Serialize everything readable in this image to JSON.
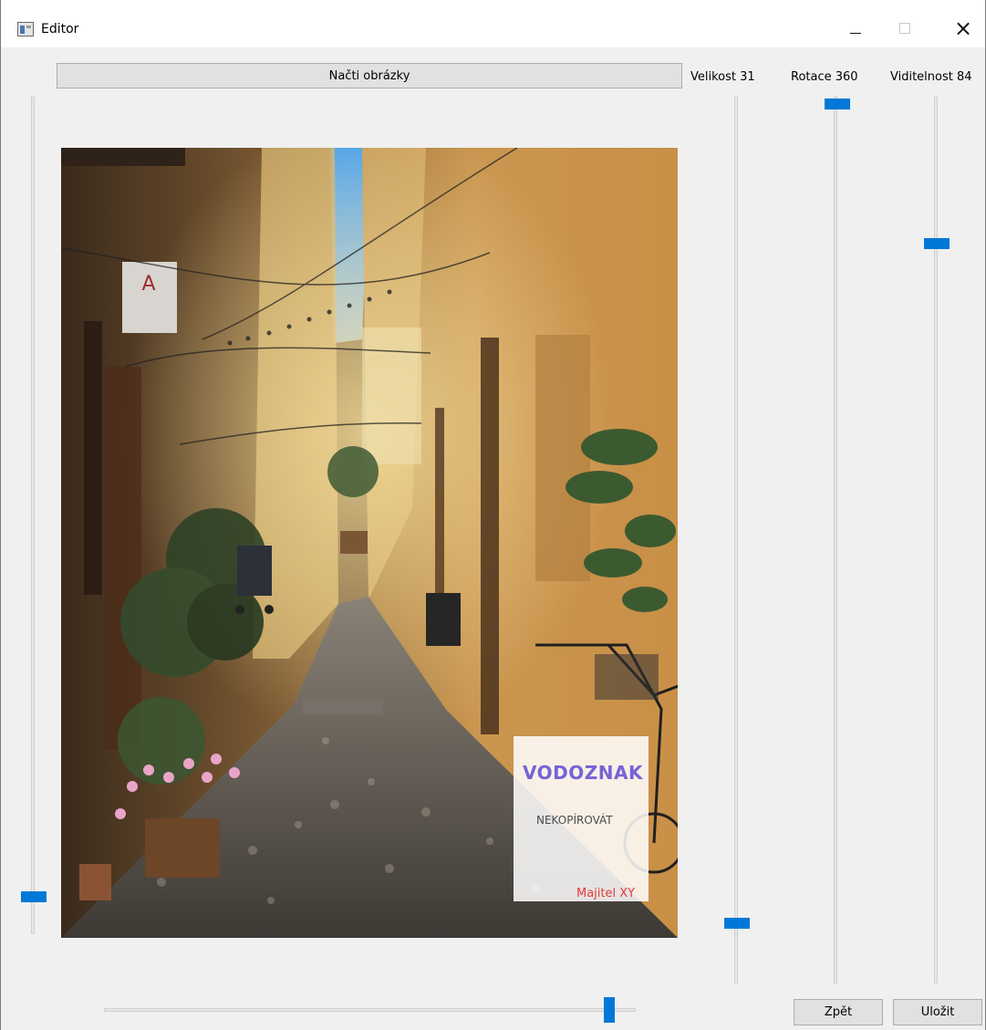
{
  "window": {
    "title": "Editor",
    "controls": {
      "minimize": "minimize-icon",
      "maximize": "maximize-icon",
      "close": "close-icon"
    }
  },
  "toolbar": {
    "load_label": "Načti obrázky",
    "size_label": "Velikost  31",
    "rotation_label": "Rotace  360",
    "visibility_label": "Viditelnost  84"
  },
  "sliders": {
    "left_vertical": {
      "value_fraction": 0.05
    },
    "bottom_horizontal": {
      "value_fraction": 0.95
    },
    "size": {
      "value": 31
    },
    "rotation": {
      "value": 360,
      "value_fraction": 1.0
    },
    "visibility": {
      "value": 84,
      "value_fraction": 0.84
    }
  },
  "watermark": {
    "title": "VODOZNAK",
    "subtitle": "NEKOPÍROVÁT",
    "owner": "Majitel XY"
  },
  "buttons": {
    "back": "Zpět",
    "save": "Uložit"
  },
  "colors": {
    "accent": "#0078d7",
    "button": "#e1e1e1",
    "watermark_title": "#7662d8",
    "watermark_owner": "#e53935"
  }
}
